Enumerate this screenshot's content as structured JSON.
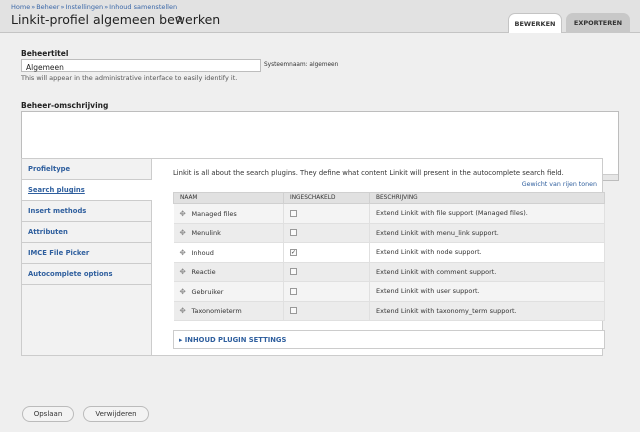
{
  "breadcrumb": [
    "Home",
    "Beheer",
    "Instellingen",
    "Inhoud samenstellen"
  ],
  "page_title": "Linkit-profiel algemeen bewerken",
  "tabs": [
    {
      "label": "Bewerken"
    },
    {
      "label": "Exporteren"
    }
  ],
  "form": {
    "title_label": "Beheertitel",
    "title_value": "Algemeen",
    "machine_name": "Systeemnaam: algemeen",
    "title_help": "This will appear in the administrative interface to easily identify it.",
    "description_label": "Beheer-omschrijving",
    "description_value": ""
  },
  "vertical_tabs": [
    {
      "label": "Profieltype"
    },
    {
      "label": "Search plugins"
    },
    {
      "label": "Insert methods"
    },
    {
      "label": "Attributen"
    },
    {
      "label": "IMCE File Picker"
    },
    {
      "label": "Autocomplete options"
    }
  ],
  "plugins_pane": {
    "intro": "Linkit is all about the search plugins. They define what content Linkit will present in the autocomplete search field.",
    "weights_link": "Gewicht van rijen tonen",
    "columns": [
      "Naam",
      "Ingeschakeld",
      "Beschrijving"
    ],
    "rows": [
      {
        "name": "Managed files",
        "enabled": false,
        "description": "Extend Linkit with file support (Managed files)."
      },
      {
        "name": "Menulink",
        "enabled": false,
        "description": "Extend Linkit with menu_link support."
      },
      {
        "name": "Inhoud",
        "enabled": true,
        "description": "Extend Linkit with node support."
      },
      {
        "name": "Reactie",
        "enabled": false,
        "description": "Extend Linkit with comment support."
      },
      {
        "name": "Gebruiker",
        "enabled": false,
        "description": "Extend Linkit with user support."
      },
      {
        "name": "Taxonomieterm",
        "enabled": false,
        "description": "Extend Linkit with taxonomy_term support."
      }
    ],
    "settings_legend": "Inhoud plugin settings"
  },
  "buttons": {
    "save": "Opslaan",
    "delete": "Verwijderen"
  },
  "colors": {
    "link": "#2f5f9e",
    "background": "#efefef"
  }
}
